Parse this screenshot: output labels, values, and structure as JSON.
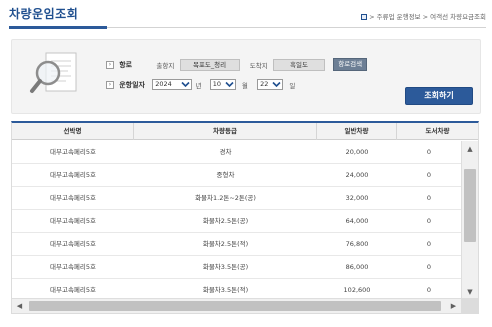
{
  "page": {
    "title": "차량운임조회",
    "breadcrumb": "> 주류업 운행정보 > 여객선 차량요금조회"
  },
  "search": {
    "route_label": "항로",
    "departure_label": "출항지",
    "departure_value": "목포도_청리",
    "arrival_label": "도착지",
    "arrival_value": "흑일도",
    "route_search_button": "항로검색",
    "date_label": "운항일자",
    "year_value": "2024",
    "year_unit": "년",
    "month_value": "10",
    "month_unit": "월",
    "day_value": "22",
    "day_unit": "일",
    "inquiry_button": "조회하기"
  },
  "grid": {
    "columns": [
      "선박명",
      "차량등급",
      "일반차량",
      "도서차량"
    ],
    "rows": [
      [
        "대부고속페리5호",
        "경차",
        "20,000",
        "0"
      ],
      [
        "대부고속페리5호",
        "중형차",
        "24,000",
        "0"
      ],
      [
        "대부고속페리5호",
        "화물차1.2톤~2톤(공)",
        "32,000",
        "0"
      ],
      [
        "대부고속페리5호",
        "화물차2.5톤(공)",
        "64,000",
        "0"
      ],
      [
        "대부고속페리5호",
        "화물차2.5톤(적)",
        "76,800",
        "0"
      ],
      [
        "대부고속페리5호",
        "화물차3.5톤(공)",
        "86,000",
        "0"
      ],
      [
        "대부고속페리5호",
        "화물차3.5톤(적)",
        "102,600",
        "0"
      ]
    ]
  },
  "icons": {
    "search_graphic": "magnifier-document-icon",
    "breadcrumb_home": "home-icon",
    "select_caret": "chevron-down-icon",
    "row_marker": "chevron-right-icon"
  },
  "colors": {
    "accent": "#2c5a9a",
    "panel_bg": "#f4f4f4",
    "button_gray": "#6d7f95"
  }
}
